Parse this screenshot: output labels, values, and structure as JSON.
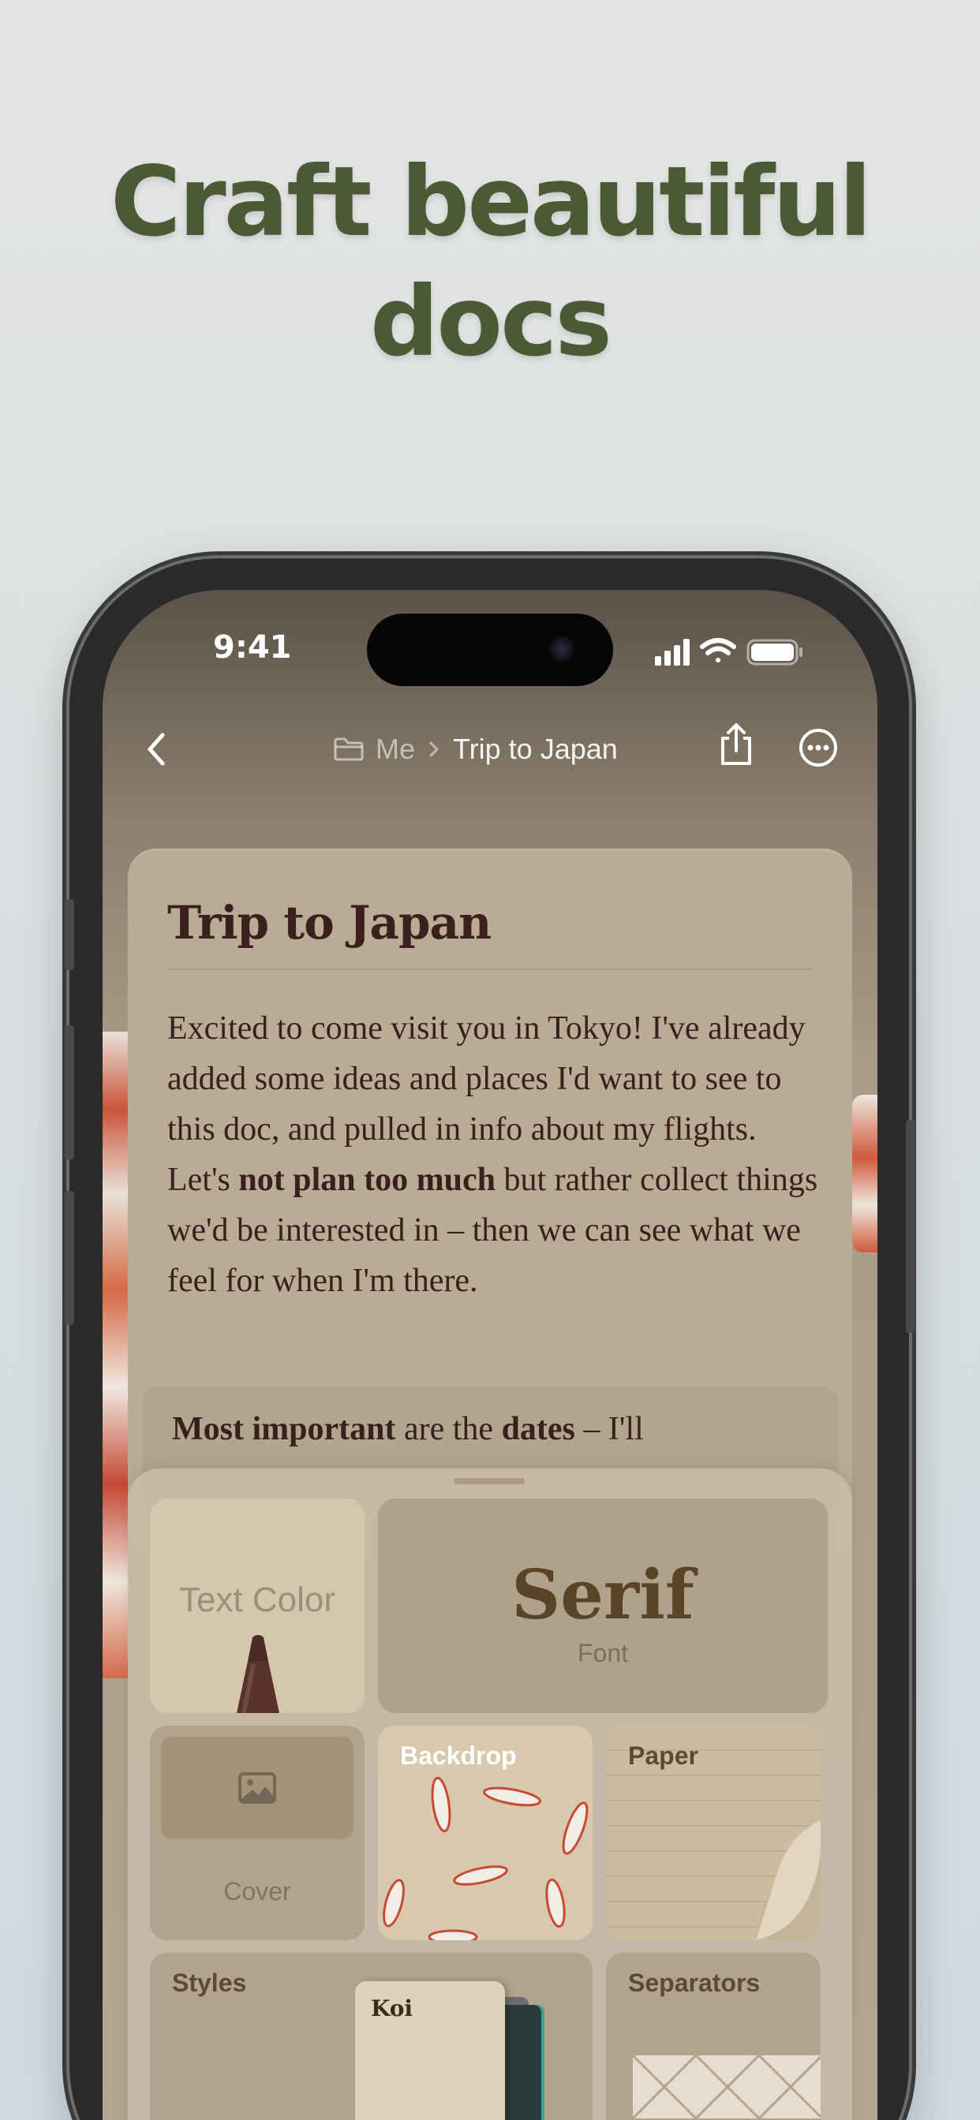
{
  "headline": {
    "line1": "Craft beautiful",
    "line2": "docs"
  },
  "status_bar": {
    "time": "9:41"
  },
  "nav": {
    "breadcrumb_parent": "Me",
    "breadcrumb_current": "Trip to Japan"
  },
  "document": {
    "title": "Trip to Japan",
    "body_part1": "Excited to come visit you in Tokyo! I've already added some ideas and places I'd want to see to this doc, and pulled in info about my flights. Let's ",
    "body_bold1": "not plan too much",
    "body_part2": " but rather collect things we'd be interested in – then we can see what we feel for when I'm there.",
    "callout_bold1": "Most important",
    "callout_part1": " are the ",
    "callout_bold2": "dates",
    "callout_part2": " – I'll"
  },
  "style_sheet": {
    "text_color_label": "Text Color",
    "font_value": "Serif",
    "font_label": "Font",
    "cover_label": "Cover",
    "backdrop_label": "Backdrop",
    "paper_label": "Paper",
    "styles_label": "Styles",
    "style_card_name": "Koi",
    "separators_label": "Separators"
  },
  "colors": {
    "headline": "#4b5a34",
    "doc_text": "#3a1f1f",
    "accent_koi": "#c9553a"
  }
}
